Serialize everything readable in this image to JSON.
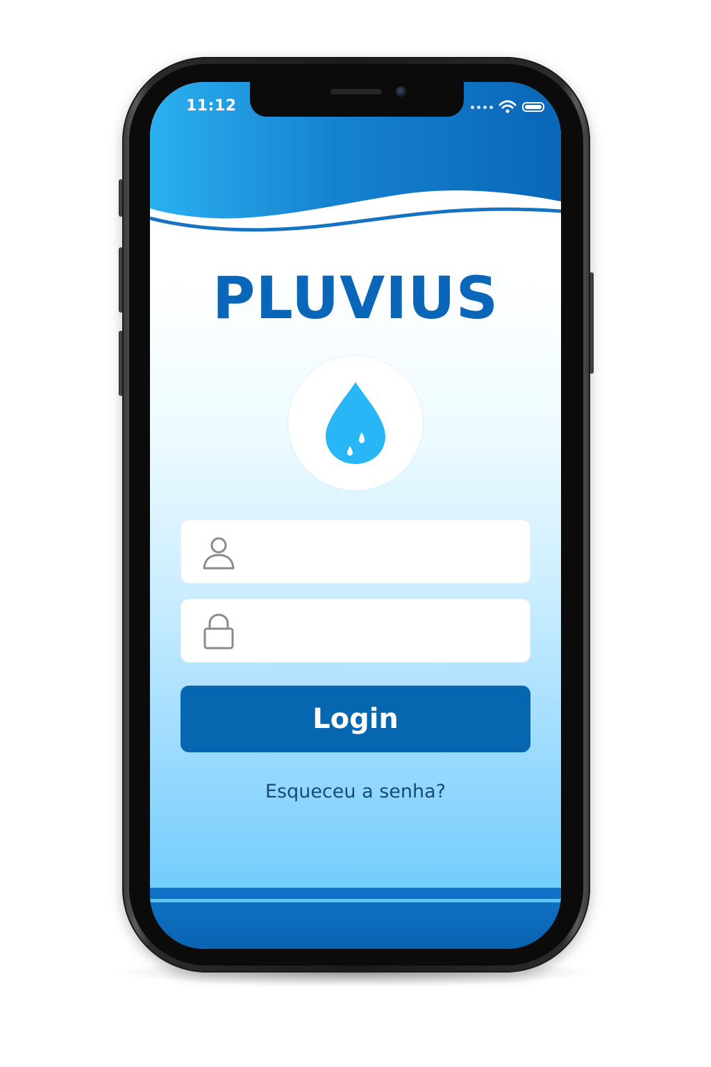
{
  "status_bar": {
    "time": "11:12",
    "icons": [
      "signal-dots-icon",
      "wifi-icon",
      "battery-icon"
    ]
  },
  "app": {
    "title": "PLUVIUS",
    "logo_icon": "water-drop-icon"
  },
  "login_form": {
    "username": {
      "icon": "user-icon",
      "value": "",
      "placeholder": ""
    },
    "password": {
      "icon": "lock-icon",
      "value": "",
      "placeholder": ""
    },
    "submit_label": "Login",
    "forgot_password_label": "Esqueceu a senha?"
  },
  "colors": {
    "brand_blue": "#0a66b8",
    "button_blue": "#0766b0",
    "drop_blue": "#29b6f6",
    "header_gradient_start": "#2aa9ec",
    "header_gradient_end": "#0a66b8",
    "footer_blue": "#0a63b3"
  }
}
